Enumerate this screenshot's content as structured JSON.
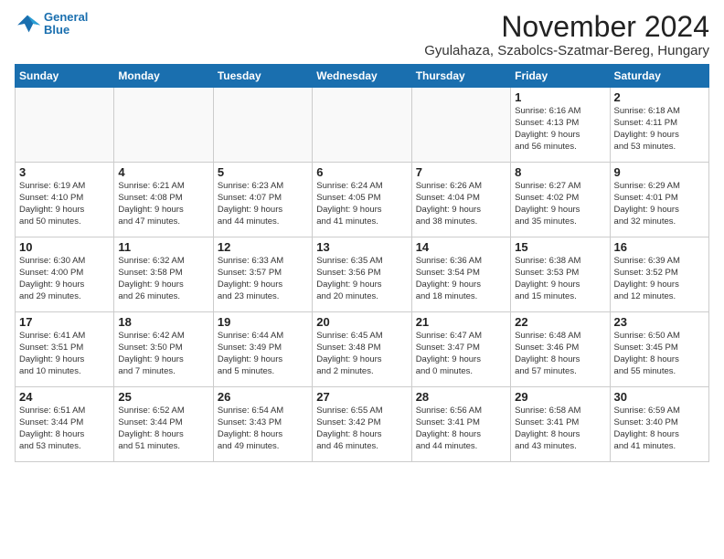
{
  "logo": {
    "line1": "General",
    "line2": "Blue"
  },
  "title": "November 2024",
  "location": "Gyulahaza, Szabolcs-Szatmar-Bereg, Hungary",
  "days_of_week": [
    "Sunday",
    "Monday",
    "Tuesday",
    "Wednesday",
    "Thursday",
    "Friday",
    "Saturday"
  ],
  "weeks": [
    [
      {
        "day": "",
        "info": ""
      },
      {
        "day": "",
        "info": ""
      },
      {
        "day": "",
        "info": ""
      },
      {
        "day": "",
        "info": ""
      },
      {
        "day": "",
        "info": ""
      },
      {
        "day": "1",
        "info": "Sunrise: 6:16 AM\nSunset: 4:13 PM\nDaylight: 9 hours\nand 56 minutes."
      },
      {
        "day": "2",
        "info": "Sunrise: 6:18 AM\nSunset: 4:11 PM\nDaylight: 9 hours\nand 53 minutes."
      }
    ],
    [
      {
        "day": "3",
        "info": "Sunrise: 6:19 AM\nSunset: 4:10 PM\nDaylight: 9 hours\nand 50 minutes."
      },
      {
        "day": "4",
        "info": "Sunrise: 6:21 AM\nSunset: 4:08 PM\nDaylight: 9 hours\nand 47 minutes."
      },
      {
        "day": "5",
        "info": "Sunrise: 6:23 AM\nSunset: 4:07 PM\nDaylight: 9 hours\nand 44 minutes."
      },
      {
        "day": "6",
        "info": "Sunrise: 6:24 AM\nSunset: 4:05 PM\nDaylight: 9 hours\nand 41 minutes."
      },
      {
        "day": "7",
        "info": "Sunrise: 6:26 AM\nSunset: 4:04 PM\nDaylight: 9 hours\nand 38 minutes."
      },
      {
        "day": "8",
        "info": "Sunrise: 6:27 AM\nSunset: 4:02 PM\nDaylight: 9 hours\nand 35 minutes."
      },
      {
        "day": "9",
        "info": "Sunrise: 6:29 AM\nSunset: 4:01 PM\nDaylight: 9 hours\nand 32 minutes."
      }
    ],
    [
      {
        "day": "10",
        "info": "Sunrise: 6:30 AM\nSunset: 4:00 PM\nDaylight: 9 hours\nand 29 minutes."
      },
      {
        "day": "11",
        "info": "Sunrise: 6:32 AM\nSunset: 3:58 PM\nDaylight: 9 hours\nand 26 minutes."
      },
      {
        "day": "12",
        "info": "Sunrise: 6:33 AM\nSunset: 3:57 PM\nDaylight: 9 hours\nand 23 minutes."
      },
      {
        "day": "13",
        "info": "Sunrise: 6:35 AM\nSunset: 3:56 PM\nDaylight: 9 hours\nand 20 minutes."
      },
      {
        "day": "14",
        "info": "Sunrise: 6:36 AM\nSunset: 3:54 PM\nDaylight: 9 hours\nand 18 minutes."
      },
      {
        "day": "15",
        "info": "Sunrise: 6:38 AM\nSunset: 3:53 PM\nDaylight: 9 hours\nand 15 minutes."
      },
      {
        "day": "16",
        "info": "Sunrise: 6:39 AM\nSunset: 3:52 PM\nDaylight: 9 hours\nand 12 minutes."
      }
    ],
    [
      {
        "day": "17",
        "info": "Sunrise: 6:41 AM\nSunset: 3:51 PM\nDaylight: 9 hours\nand 10 minutes."
      },
      {
        "day": "18",
        "info": "Sunrise: 6:42 AM\nSunset: 3:50 PM\nDaylight: 9 hours\nand 7 minutes."
      },
      {
        "day": "19",
        "info": "Sunrise: 6:44 AM\nSunset: 3:49 PM\nDaylight: 9 hours\nand 5 minutes."
      },
      {
        "day": "20",
        "info": "Sunrise: 6:45 AM\nSunset: 3:48 PM\nDaylight: 9 hours\nand 2 minutes."
      },
      {
        "day": "21",
        "info": "Sunrise: 6:47 AM\nSunset: 3:47 PM\nDaylight: 9 hours\nand 0 minutes."
      },
      {
        "day": "22",
        "info": "Sunrise: 6:48 AM\nSunset: 3:46 PM\nDaylight: 8 hours\nand 57 minutes."
      },
      {
        "day": "23",
        "info": "Sunrise: 6:50 AM\nSunset: 3:45 PM\nDaylight: 8 hours\nand 55 minutes."
      }
    ],
    [
      {
        "day": "24",
        "info": "Sunrise: 6:51 AM\nSunset: 3:44 PM\nDaylight: 8 hours\nand 53 minutes."
      },
      {
        "day": "25",
        "info": "Sunrise: 6:52 AM\nSunset: 3:44 PM\nDaylight: 8 hours\nand 51 minutes."
      },
      {
        "day": "26",
        "info": "Sunrise: 6:54 AM\nSunset: 3:43 PM\nDaylight: 8 hours\nand 49 minutes."
      },
      {
        "day": "27",
        "info": "Sunrise: 6:55 AM\nSunset: 3:42 PM\nDaylight: 8 hours\nand 46 minutes."
      },
      {
        "day": "28",
        "info": "Sunrise: 6:56 AM\nSunset: 3:41 PM\nDaylight: 8 hours\nand 44 minutes."
      },
      {
        "day": "29",
        "info": "Sunrise: 6:58 AM\nSunset: 3:41 PM\nDaylight: 8 hours\nand 43 minutes."
      },
      {
        "day": "30",
        "info": "Sunrise: 6:59 AM\nSunset: 3:40 PM\nDaylight: 8 hours\nand 41 minutes."
      }
    ]
  ]
}
